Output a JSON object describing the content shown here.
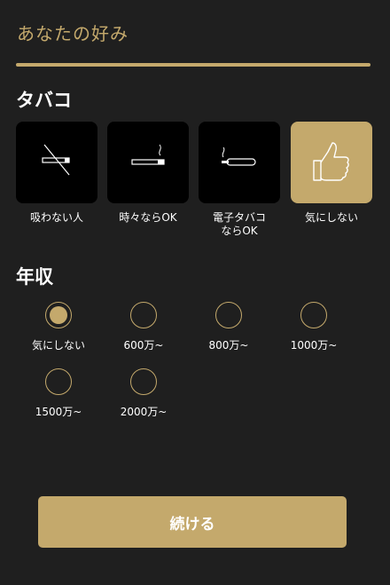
{
  "header": {
    "title": "あなたの好み"
  },
  "tabacco": {
    "title": "タバコ",
    "options": [
      {
        "label": "吸わない人",
        "icon": "no-smoking-icon",
        "selected": false
      },
      {
        "label": "時々ならOK",
        "icon": "cigarette-icon",
        "selected": false
      },
      {
        "label": "電子タバコ\nならOK",
        "icon": "e-cigarette-icon",
        "selected": false
      },
      {
        "label": "気にしない",
        "icon": "thumbs-up-icon",
        "selected": true
      }
    ]
  },
  "income": {
    "title": "年収",
    "options": [
      {
        "label": "気にしない",
        "selected": true
      },
      {
        "label": "600万~",
        "selected": false
      },
      {
        "label": "800万~",
        "selected": false
      },
      {
        "label": "1000万~",
        "selected": false
      },
      {
        "label": "1500万~",
        "selected": false
      },
      {
        "label": "2000万~",
        "selected": false
      }
    ]
  },
  "continue_label": "続ける",
  "colors": {
    "accent": "#c4a96c",
    "background": "#1f1f1f",
    "card": "#000000"
  }
}
